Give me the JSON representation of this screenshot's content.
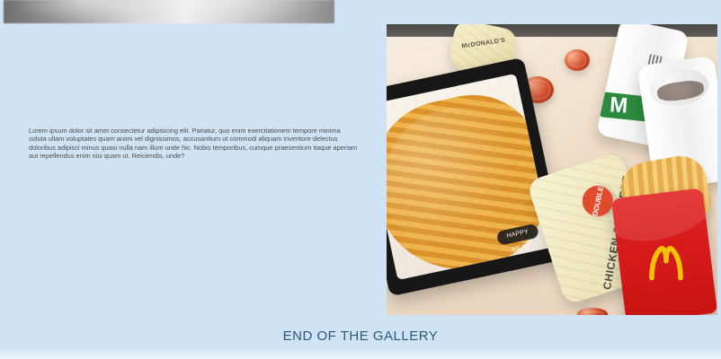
{
  "gallery": {
    "body_text": "Lorem ipsum dolor sit amet consectetur adipisicing elit. Pariatur, quo enim exercitationem tempore minima soluta ullam voluptates quam animi vel dignissimos, accusantium ut commodi aliquam inventore delectus doloribus adipisci minus quasi nulla nam illum unde hic. Nobis temporibus, cumque praesentium itaque aperiam aut repellendus enim nisi quam ut. Reiciendis, unde?",
    "end_label": "END OF THE GALLERY"
  },
  "photo": {
    "tray_logo": "HAPPY MEAL",
    "burger_top_text": "McDONALD'S",
    "wrap_badge": "DOUBLE",
    "wrap_text": "CHICKEN & CHEESE"
  },
  "colors": {
    "background": "#cfe3f5",
    "title": "#2f5877",
    "body": "#4c4c4c",
    "mcd_red": "#c81414",
    "mcd_yellow": "#f2c200",
    "mcd_green": "#2b8a3e"
  },
  "icons": {
    "arches": "golden-arches-icon"
  }
}
